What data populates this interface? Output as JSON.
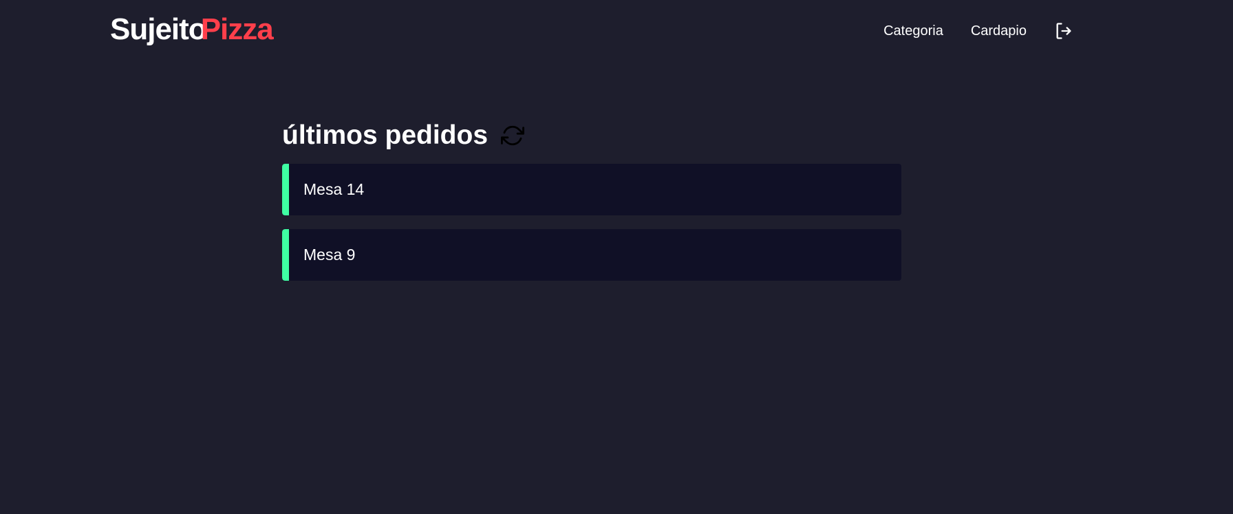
{
  "header": {
    "logo_part1": "Sujeito",
    "logo_part2": "Pizza",
    "nav": {
      "categoria": "Categoria",
      "cardapio": "Cardapio"
    },
    "logout_icon": "logout-icon"
  },
  "main": {
    "title": "últimos pedidos",
    "refresh_icon": "refresh-icon",
    "orders": [
      {
        "label": "Mesa 14"
      },
      {
        "label": "Mesa 9"
      }
    ]
  },
  "colors": {
    "background": "#1e1e2d",
    "card": "#101026",
    "accent_red": "#ff3f4b",
    "accent_green": "#3fffa3"
  }
}
